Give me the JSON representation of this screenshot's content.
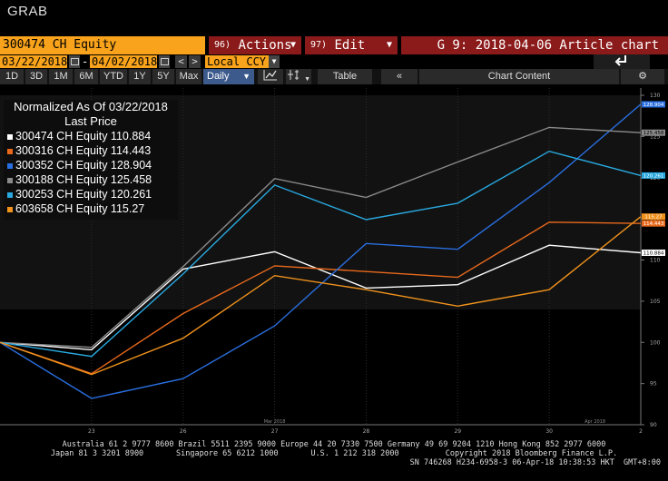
{
  "app": {
    "grab_label": "GRAB"
  },
  "toolbar": {
    "ticker": "300474 CH Equity",
    "actions_num": "96)",
    "actions_label": "Actions",
    "edit_num": "97)",
    "edit_label": "Edit",
    "chart_title": "G 9: 2018-04-06 Article chart"
  },
  "range": {
    "start_date": "03/22/2018",
    "end_date": "04/02/2018",
    "currency": "Local CCY",
    "prev": "<",
    "next": ">",
    "dash": "-"
  },
  "periods": [
    "1D",
    "3D",
    "1M",
    "6M",
    "YTD",
    "1Y",
    "5Y",
    "Max"
  ],
  "controls": {
    "frequency": "Daily",
    "table": "Table",
    "collapse": "«",
    "chart_content": "Chart Content",
    "gear": "⚙"
  },
  "legend": {
    "title1": "Normalized As Of 03/22/2018",
    "title2": "Last Price",
    "items": [
      {
        "label": "300474 CH Equity 110.884",
        "color": "#ffffff"
      },
      {
        "label": "300316 CH Equity 114.443",
        "color": "#e8691c"
      },
      {
        "label": "300352 CH Equity 128.904",
        "color": "#2a6fe0"
      },
      {
        "label": "300188 CH Equity 125.458",
        "color": "#8a8a8a"
      },
      {
        "label": "300253 CH Equity 120.261",
        "color": "#29a9e0"
      },
      {
        "label": "603658 CH Equity 115.27",
        "color": "#f0921c"
      }
    ]
  },
  "chart_data": {
    "type": "line",
    "x": [
      "22",
      "23",
      "26",
      "27",
      "28",
      "29",
      "30",
      "2"
    ],
    "x_labels": [
      "23",
      "26",
      "27",
      "28",
      "29",
      "30",
      "2"
    ],
    "month_labels": [
      {
        "text": "Mar 2018",
        "at": "27"
      },
      {
        "text": "Apr 2018",
        "at": "30"
      }
    ],
    "ylim": [
      90,
      130
    ],
    "yticks": [
      90,
      95,
      100,
      105,
      110,
      115,
      120,
      125,
      130
    ],
    "series": [
      {
        "name": "300474 CH Equity",
        "color": "#ffffff",
        "values": [
          100,
          99.1,
          108.9,
          111.0,
          106.6,
          107.0,
          111.8,
          110.884
        ]
      },
      {
        "name": "300316 CH Equity",
        "color": "#e8691c",
        "values": [
          100,
          96.2,
          103.5,
          109.3,
          108.6,
          107.9,
          114.6,
          114.443
        ]
      },
      {
        "name": "300352 CH Equity",
        "color": "#2a6fe0",
        "values": [
          100,
          93.2,
          95.6,
          102.0,
          112.0,
          111.3,
          119.4,
          128.904
        ]
      },
      {
        "name": "300188 CH Equity",
        "color": "#8a8a8a",
        "values": [
          100,
          99.4,
          109.2,
          119.9,
          117.6,
          121.9,
          126.1,
          125.458
        ]
      },
      {
        "name": "300253 CH Equity",
        "color": "#29a9e0",
        "values": [
          100,
          98.3,
          108.3,
          119.1,
          114.9,
          116.9,
          123.2,
          120.261
        ]
      },
      {
        "name": "603658 CH Equity",
        "color": "#f0921c",
        "values": [
          100,
          96.1,
          100.5,
          108.1,
          106.4,
          104.4,
          106.4,
          115.27
        ]
      }
    ],
    "last_labels": [
      {
        "text": "128.904",
        "value": 128.904,
        "color": "#2a6fe0"
      },
      {
        "text": "125.458",
        "value": 125.458,
        "color": "#8a8a8a"
      },
      {
        "text": "120.261",
        "value": 120.261,
        "color": "#29a9e0"
      },
      {
        "text": "115.27",
        "value": 115.27,
        "color": "#f0921c"
      },
      {
        "text": "114.443",
        "value": 114.443,
        "color": "#e8691c"
      },
      {
        "text": "110.884",
        "value": 110.884,
        "color": "#ffffff"
      }
    ]
  },
  "footer": {
    "line1": "Australia 61 2 9777 8600 Brazil 5511 2395 9000 Europe 44 20 7330 7500 Germany 49 69 9204 1210 Hong Kong 852 2977 6000",
    "line2": "Japan 81 3 3201 8900       Singapore 65 6212 1000       U.S. 1 212 318 2000          Copyright 2018 Bloomberg Finance L.P.",
    "line3": "SN 746268 H234-6958-3 06-Apr-18 10:38:53 HKT  GMT+8:00"
  }
}
